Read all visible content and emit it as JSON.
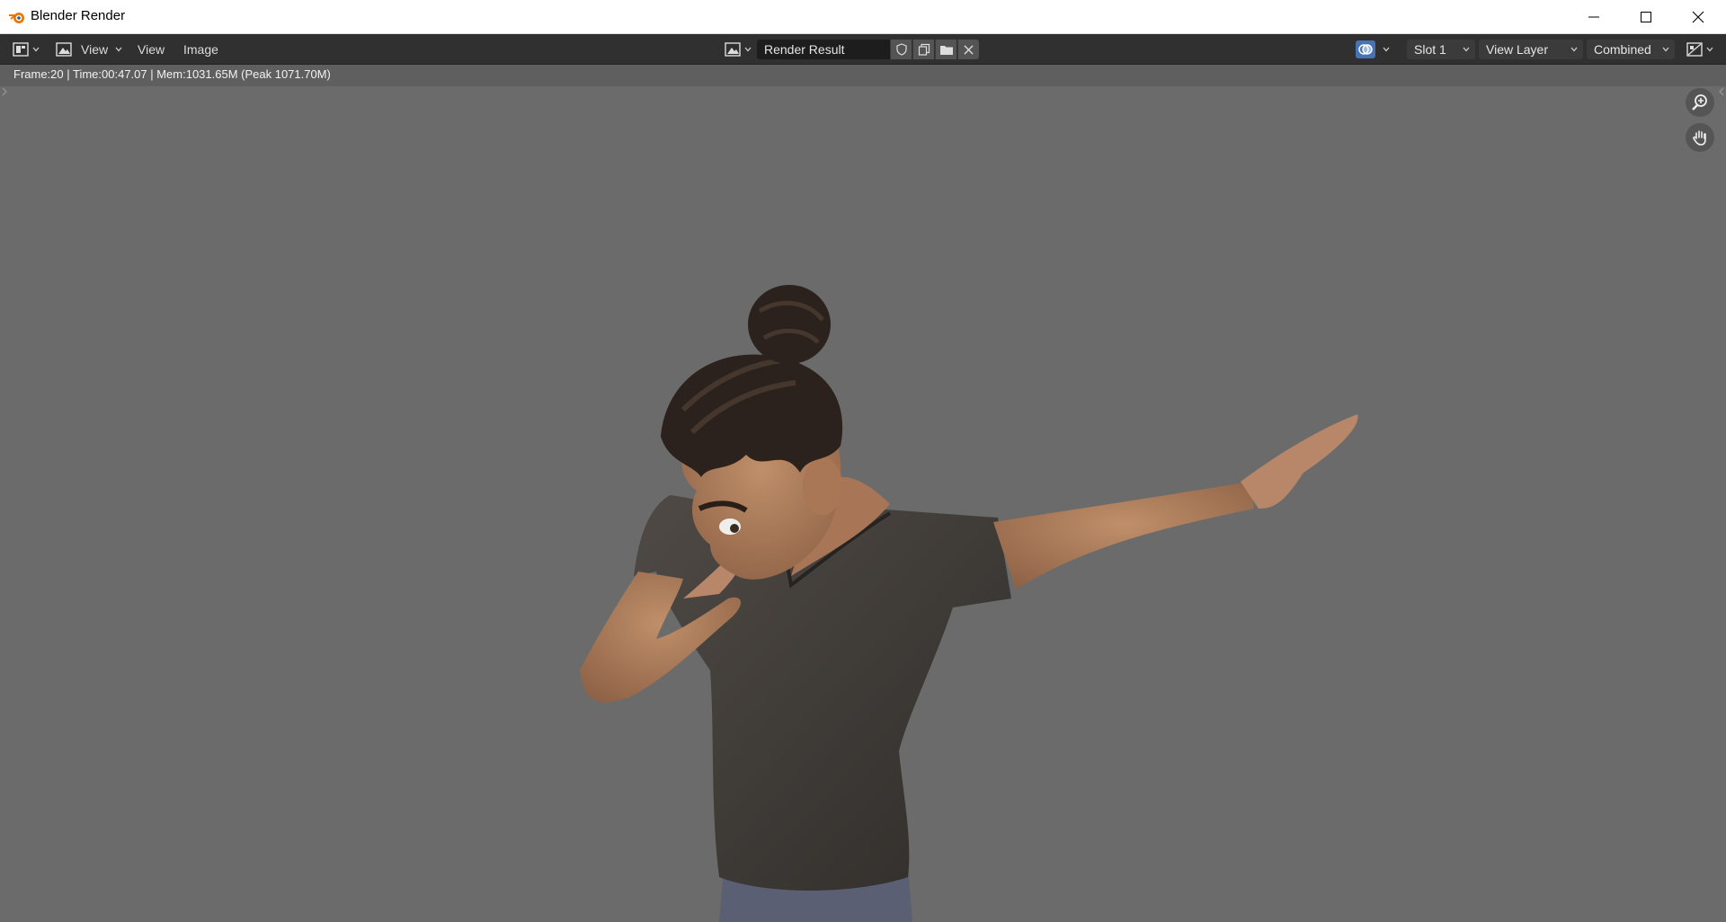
{
  "window": {
    "title": "Blender Render",
    "controls": [
      "minimize-icon",
      "maximize-icon",
      "close-icon"
    ]
  },
  "header": {
    "menus": [
      "View",
      "Image"
    ],
    "image_name": "Render Result",
    "slot": "Slot 1",
    "view_layer": "View Layer",
    "pass": "Combined"
  },
  "info": {
    "status": "Frame:20 | Time:00:47.07 | Mem:1031.65M (Peak 1071.70M)"
  },
  "colors": {
    "accent": "#4772b3",
    "viewport_bg": "#6b6b6b",
    "header_bg": "#303030",
    "logo_orange": "#ea7600"
  },
  "icons": [
    "blender-logo-icon",
    "editor-type-icon",
    "image-mode-icon",
    "image-browse-icon",
    "fake-user-shield-icon",
    "duplicate-icon",
    "open-folder-icon",
    "unlink-x-icon",
    "display-channels-icon",
    "view-layer-icon",
    "zoom-icon",
    "pan-hand-icon"
  ]
}
